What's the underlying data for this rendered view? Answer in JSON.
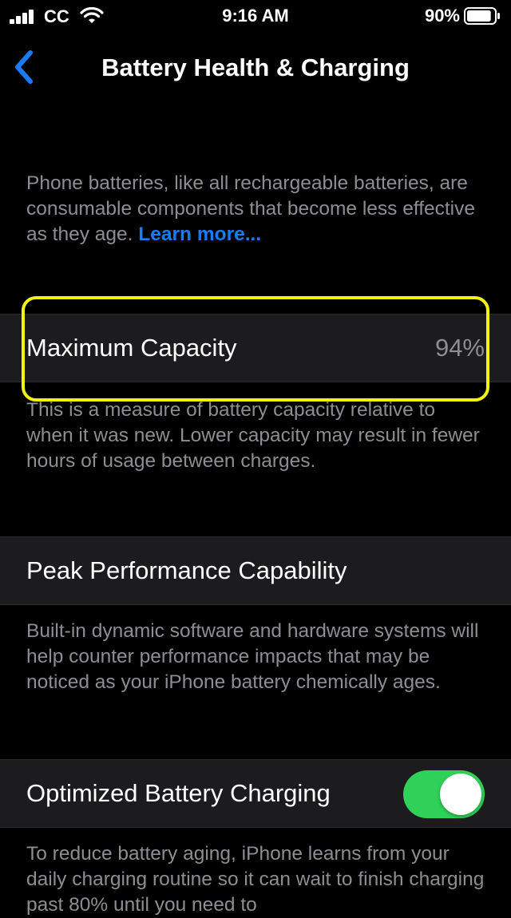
{
  "status_bar": {
    "carrier": "CC",
    "time": "9:16 AM",
    "battery_percent": "90%",
    "battery_level": 0.9
  },
  "nav": {
    "title": "Battery Health & Charging",
    "back_icon": "chevron-left-icon"
  },
  "intro": {
    "text": "Phone batteries, like all rechargeable batteries, are consumable components that become less effective as they age. ",
    "link": "Learn more..."
  },
  "maximum_capacity": {
    "label": "Maximum Capacity",
    "value": "94%",
    "footnote": "This is a measure of battery capacity relative to when it was new. Lower capacity may result in fewer hours of usage between charges."
  },
  "peak_performance": {
    "label": "Peak Performance Capability",
    "footnote": "Built-in dynamic software and hardware systems will help counter performance impacts that may be noticed as your iPhone battery chemically ages."
  },
  "optimized_charging": {
    "label": "Optimized Battery Charging",
    "enabled": true,
    "footnote": "To reduce battery aging, iPhone learns from your daily charging routine so it can wait to finish charging past 80% until you need to"
  },
  "colors": {
    "accent": "#1a7cf5",
    "toggle_on": "#30d158",
    "highlight": "#f3f310",
    "cell_bg": "#1c1c1e",
    "secondary_text": "#8d8d93"
  }
}
